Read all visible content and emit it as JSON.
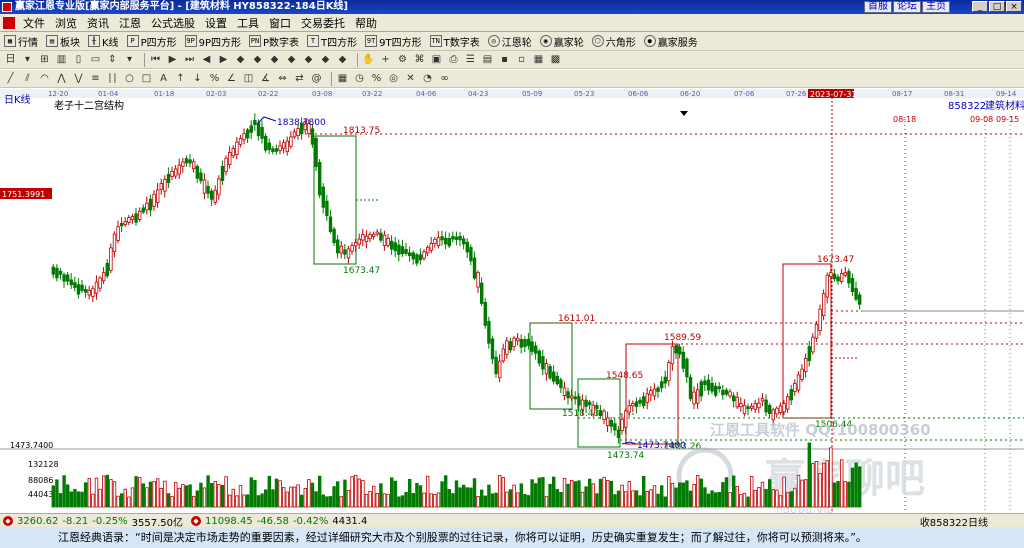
{
  "window": {
    "title": "赢家江恩专业版[赢家内部服务平台] - [建筑材料  HY858322-184日K线]",
    "links": [
      "首服",
      "论坛",
      "主页"
    ],
    "buttons": [
      "_",
      "□",
      "×"
    ]
  },
  "menu": [
    "文件",
    "浏览",
    "资讯",
    "江恩",
    "公式选股",
    "设置",
    "工具",
    "窗口",
    "交易委托",
    "帮助"
  ],
  "toolbar": [
    {
      "icon": "grid-icon",
      "label": "行情"
    },
    {
      "icon": "block-icon",
      "label": "板块"
    },
    {
      "icon": "kline-icon",
      "label": "K线"
    },
    {
      "icon": "p-square-icon",
      "label": "P四方形"
    },
    {
      "icon": "9p-square-icon",
      "label": "9P四方形"
    },
    {
      "icon": "p-digit-icon",
      "label": "P数字表"
    },
    {
      "icon": "t-square-icon",
      "label": "T四方形"
    },
    {
      "icon": "9t-square-icon",
      "label": "9T四方形"
    },
    {
      "icon": "t-digit-icon",
      "label": "T数字表"
    },
    {
      "icon": "gann-wheel-icon",
      "label": "江恩轮"
    },
    {
      "icon": "winner-wheel-icon",
      "label": "赢家轮"
    },
    {
      "icon": "hexagon-icon",
      "label": "六角形"
    },
    {
      "icon": "service-icon",
      "label": "赢家服务"
    }
  ],
  "chart_header": {
    "period_label": "日K线",
    "study_label": "老子十二宫结构",
    "code": "858322",
    "name": "建筑材料",
    "cursor_date": "2023-07-31",
    "cursor_price_label": "1751.3991",
    "volume_label_high": "1473.7400"
  },
  "date_axis": [
    "12-20",
    "01-04",
    "01-18",
    "02-03",
    "02-22",
    "03-08",
    "03-22",
    "04-06",
    "04-23",
    "05-09",
    "05-23",
    "06-06",
    "06-20",
    "07-06",
    "07-26",
    "08-17",
    "08-31",
    "09-14"
  ],
  "future_dates": [
    "08-18",
    "09-08",
    "09-15"
  ],
  "price_annotations": [
    {
      "text": "1838.7800",
      "color": "#0000c0"
    },
    {
      "text": "1813.75",
      "color": "#c00000"
    },
    {
      "text": "1673.47",
      "color": "#007000"
    },
    {
      "text": "1611.01",
      "color": "#c00000"
    },
    {
      "text": "1589.59",
      "color": "#c00000"
    },
    {
      "text": "1548.65",
      "color": "#c00000"
    },
    {
      "text": "1518.43",
      "color": "#007000"
    },
    {
      "text": "1473.7400",
      "color": "#0000c0"
    },
    {
      "text": "1483.26",
      "color": "#007000"
    },
    {
      "text": "1473.74",
      "color": "#007000"
    },
    {
      "text": "1673.47",
      "color": "#c00000"
    },
    {
      "text": "1506.44",
      "color": "#007000"
    }
  ],
  "volume_axis": [
    "132128",
    "88086",
    "44043"
  ],
  "watermark": [
    "江恩工具软件 QQ:100800360",
    "赢家聊吧",
    "jiaoba.vip"
  ],
  "status": [
    {
      "icon": "sh-index-icon",
      "value": "3260.62",
      "change": "-8.21",
      "pct": "-0.25%",
      "amount": "3557.50亿"
    },
    {
      "icon": "sz-index-icon",
      "value": "11098.45",
      "change": "-46.58",
      "pct": "-0.42%",
      "amount": "4431.4"
    }
  ],
  "status_right": "收858322日线",
  "quote": "江恩经典语录：“时间是决定市场走势的重要因素，经过详细研究大市及个别股票的过往记录，你将可以证明，历史确实重复发生；而了解过往，你将可以预测将来。”。",
  "colors": {
    "up": "#c00000",
    "down": "#007a00",
    "title_bar": "#0a2a9a",
    "cursor": "#c00000"
  }
}
